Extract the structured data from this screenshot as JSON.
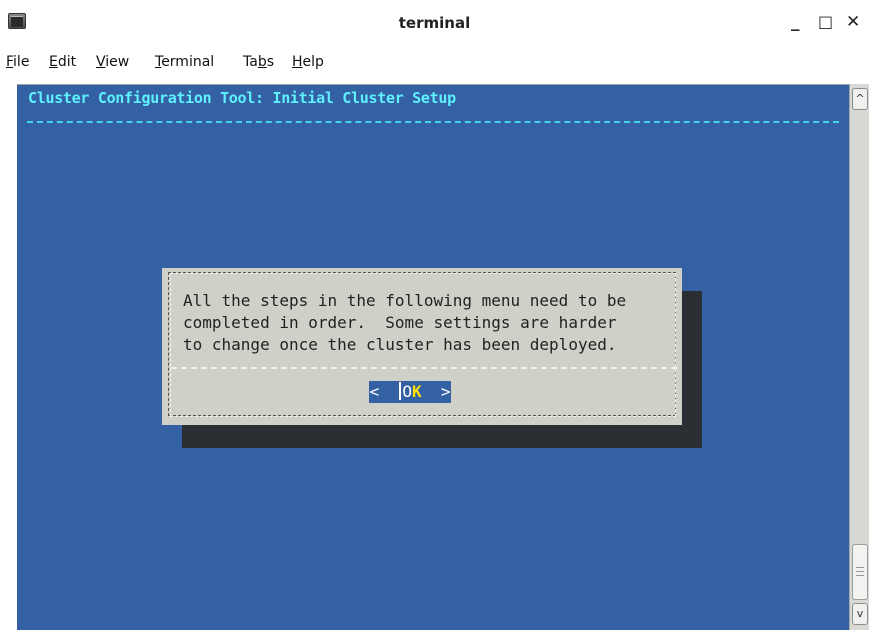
{
  "window": {
    "title": "terminal",
    "controls": {
      "minimize": "_",
      "maximize": "□",
      "close": "✕"
    }
  },
  "menubar": {
    "items": [
      {
        "mnemonic": "F",
        "rest": "ile"
      },
      {
        "mnemonic": "E",
        "rest": "dit"
      },
      {
        "mnemonic": "V",
        "rest": "iew"
      },
      {
        "mnemonic": "T",
        "rest": "erminal"
      },
      {
        "before": "Ta",
        "mnemonic": "b",
        "rest": "s"
      },
      {
        "mnemonic": "H",
        "rest": "elp"
      }
    ]
  },
  "terminal": {
    "header": "Cluster Configuration Tool: Initial Cluster Setup",
    "colors": {
      "background": "#3361a3",
      "header_text": "#5ff1ff",
      "dialog": "#cfd0c8",
      "shadow": "#2b2e33"
    }
  },
  "dialog": {
    "message_lines": [
      "All the steps in the following menu need to be",
      "completed in order.  Some settings are harder",
      "to change once the cluster has been deployed."
    ],
    "ok_button": {
      "left": "<  ",
      "before": "O",
      "hotkey": "K",
      "right": "  >"
    }
  },
  "scrollbar": {
    "up": "^",
    "down": "v"
  }
}
